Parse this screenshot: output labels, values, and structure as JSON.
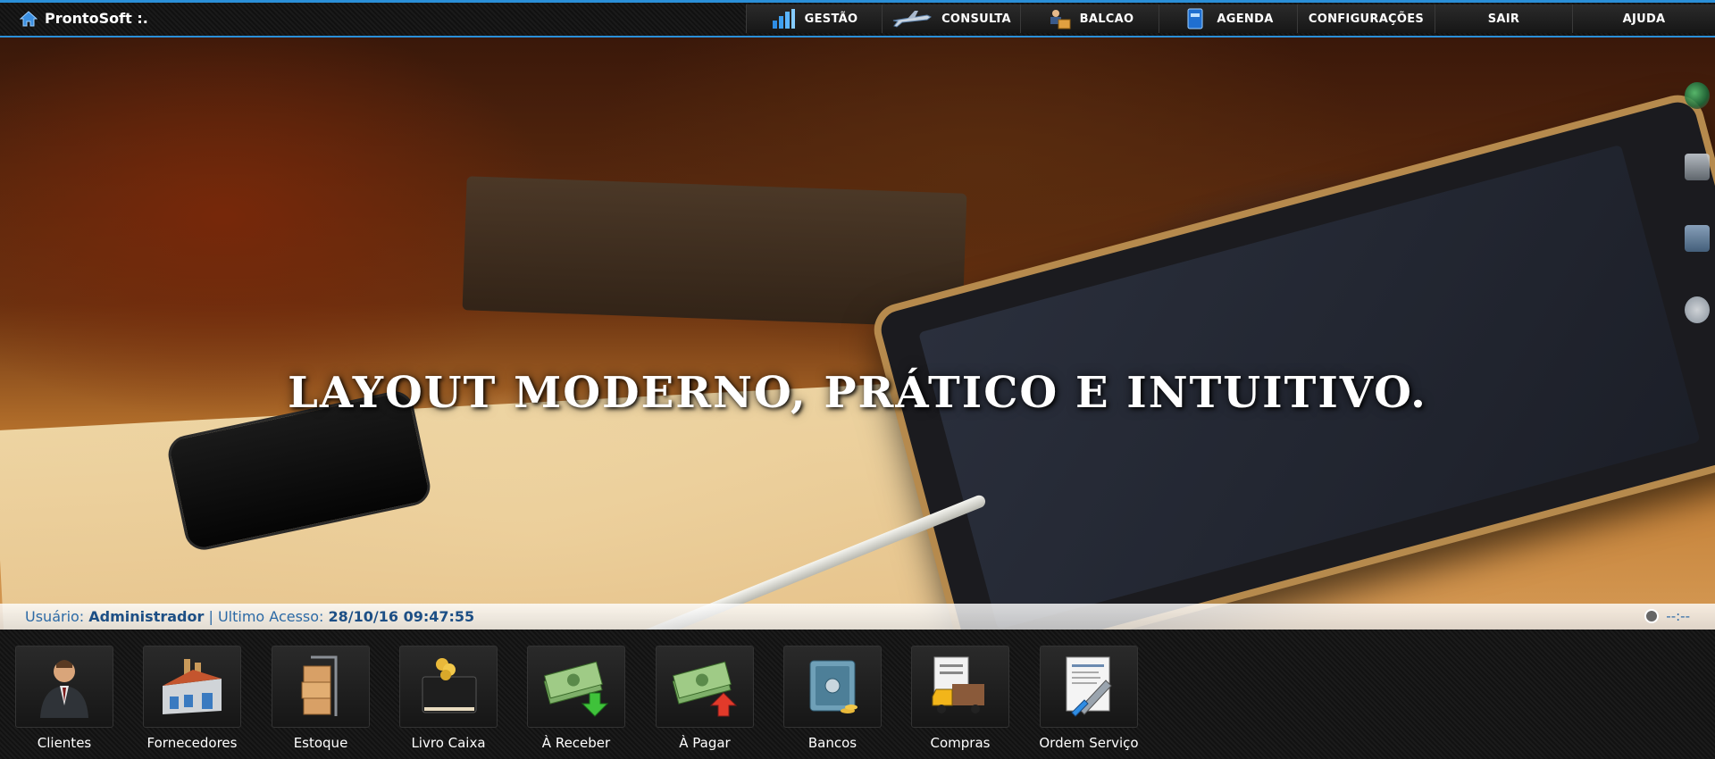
{
  "brand": {
    "name": "ProntoSoft :."
  },
  "menu": [
    {
      "label": "GESTÃO",
      "icon": "bar-chart-icon"
    },
    {
      "label": "CONSULTA",
      "icon": "airplane-icon"
    },
    {
      "label": "BALCAO",
      "icon": "cashier-icon"
    },
    {
      "label": "AGENDA",
      "icon": "agenda-book-icon"
    },
    {
      "label": "CONFIGURAÇÕES",
      "icon": ""
    },
    {
      "label": "SAIR",
      "icon": ""
    },
    {
      "label": "AJUDA",
      "icon": ""
    }
  ],
  "hero": {
    "headline": "LAYOUT MODERNO, PRÁTICO E INTUITIVO."
  },
  "status": {
    "user_label": "Usuário:",
    "user_value": "Administrador",
    "separator": "|",
    "access_label": "Ultimo Acesso:",
    "access_value": "28/10/16 09:47:55",
    "clock_value": "--:--"
  },
  "dock": [
    {
      "label": "Clientes",
      "icon": "client-person-icon"
    },
    {
      "label": "Fornecedores",
      "icon": "factory-icon"
    },
    {
      "label": "Estoque",
      "icon": "boxes-cart-icon"
    },
    {
      "label": "Livro Caixa",
      "icon": "ledger-book-icon"
    },
    {
      "label": "À Receber",
      "icon": "money-in-icon"
    },
    {
      "label": "À Pagar",
      "icon": "money-out-icon"
    },
    {
      "label": "Bancos",
      "icon": "safe-icon"
    },
    {
      "label": "Compras",
      "icon": "purchase-truck-icon"
    },
    {
      "label": "Ordem Serviço",
      "icon": "service-order-icon"
    }
  ],
  "colors": {
    "accent": "#2a8fd8",
    "status_text": "#2c6aa6",
    "status_bold": "#1d4f85"
  }
}
